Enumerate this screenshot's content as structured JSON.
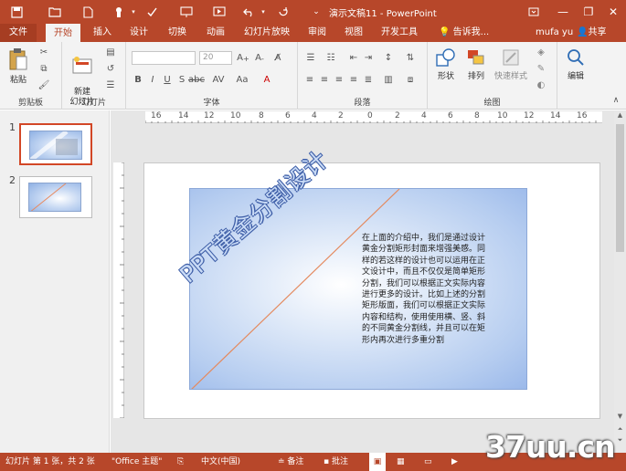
{
  "titlebar": {
    "title": "演示文稿11 - PowerPoint",
    "minimize": "—",
    "restore": "❐",
    "close": "✕",
    "help": "?"
  },
  "tabs": [
    {
      "label": "文件"
    },
    {
      "label": "开始"
    },
    {
      "label": "插入"
    },
    {
      "label": "设计"
    },
    {
      "label": "切换"
    },
    {
      "label": "动画"
    },
    {
      "label": "幻灯片放映"
    },
    {
      "label": "审阅"
    },
    {
      "label": "视图"
    },
    {
      "label": "开发工具"
    }
  ],
  "tellme": "告诉我...",
  "user": "mufa yu",
  "share": "共享",
  "ribbon": {
    "clipboard": {
      "paste": "粘贴",
      "label": "剪贴板"
    },
    "slides": {
      "new_slide": "新建\n幻灯片",
      "label": "幻灯片"
    },
    "font": {
      "size": "20",
      "label": "字体"
    },
    "paragraph": {
      "label": "段落"
    },
    "drawing": {
      "shape": "形状",
      "arrange": "排列",
      "quick_style": "快速样式",
      "label": "绘图"
    },
    "editing": {
      "label": "编辑"
    }
  },
  "thumbs": [
    {
      "num": "1"
    },
    {
      "num": "2"
    }
  ],
  "ruler": {
    "labels": [
      "16",
      "14",
      "12",
      "10",
      "8",
      "6",
      "4",
      "2",
      "0",
      "2",
      "4",
      "6",
      "8",
      "10",
      "12",
      "14",
      "16"
    ]
  },
  "slide": {
    "heading": "PPT黄金分割设计",
    "body": [
      "在上面的介绍中，我们是通过设计",
      "黄金分割矩形封面来增强美感。同",
      "样的若这样的设计也可以运用在正",
      "文设计中，而且不仅仅是简单矩形",
      "分割，我们可以根据正文实际内容",
      "进行更多的设计。比如上述的分割",
      "矩形版面，我们可以根据正文实际",
      "内容和结构，使用使用横、竖、斜",
      "的不同黄金分割线，并且可以在矩",
      "形内再次进行多重分割"
    ]
  },
  "status": {
    "slide_info": "幻灯片 第 1 张，共 2 张",
    "theme": "\"Office 主题\"",
    "lang": "中文(中国)",
    "notes": "备注",
    "comments": "批注"
  },
  "watermark": "37uu.cn",
  "colors": {
    "accent": "#b7472a",
    "ribbon": "#f3f3f3"
  }
}
